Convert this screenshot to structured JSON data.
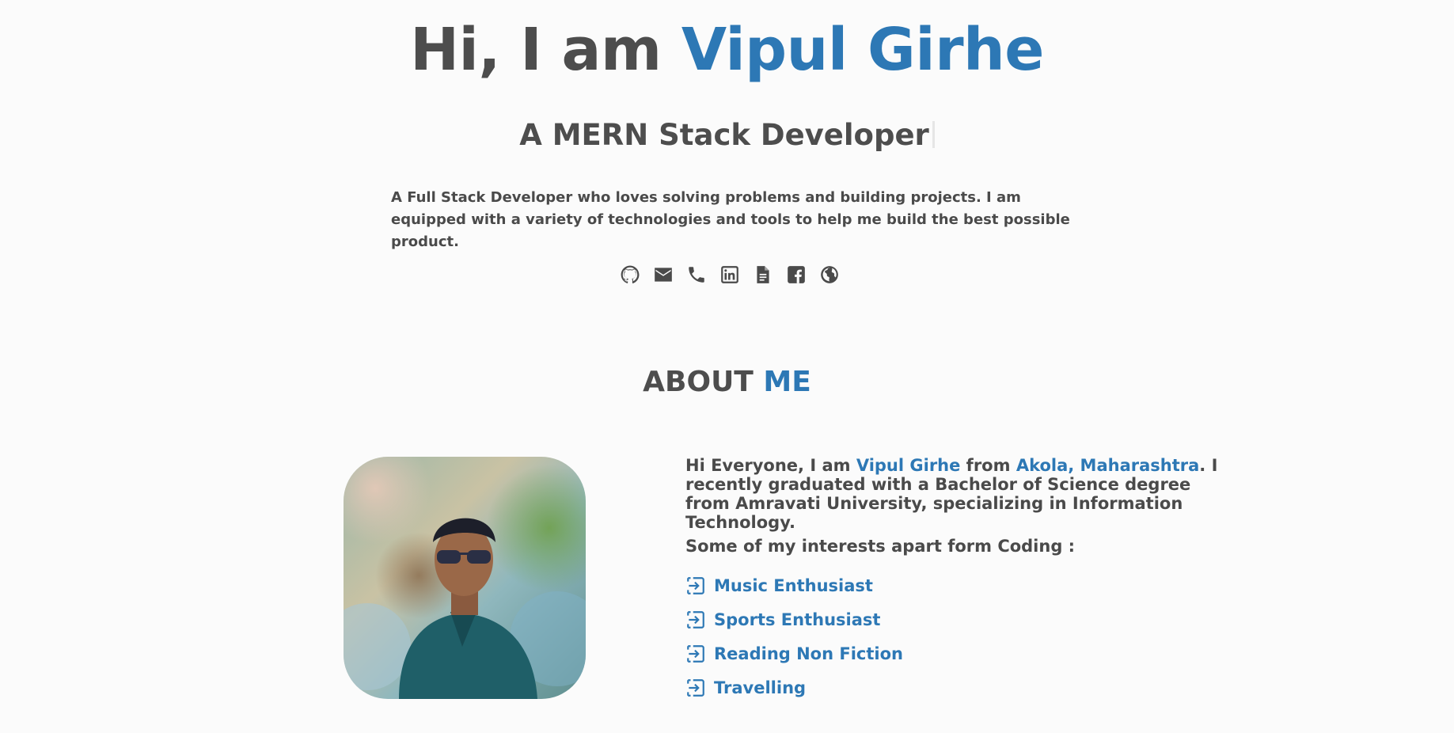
{
  "hero": {
    "greeting": "Hi, I am ",
    "name": "Vipul Girhe",
    "subtitle": "A MERN Stack Developer",
    "intro": "A Full Stack Developer who loves solving problems and building projects. I am equipped with a variety of technologies and tools to help me build the best possible product."
  },
  "socials": [
    {
      "icon": "github-icon"
    },
    {
      "icon": "email-icon"
    },
    {
      "icon": "phone-icon"
    },
    {
      "icon": "linkedin-icon"
    },
    {
      "icon": "document-icon"
    },
    {
      "icon": "facebook-icon"
    },
    {
      "icon": "globe-icon"
    }
  ],
  "about": {
    "title_part1": "ABOUT ",
    "title_part2": "ME",
    "p_start": "Hi Everyone, I am ",
    "p_name": "Vipul Girhe",
    "p_mid": " from ",
    "p_place": "Akola, Maharashtra",
    "p_end": ". I recently graduated with a Bachelor of Science degree from Amravati University, specializing in Information Technology.",
    "interests_label": "Some of my interests apart form Coding :",
    "interests": [
      "Music Enthusiast",
      "Sports Enthusiast",
      "Reading Non Fiction",
      "Travelling"
    ]
  },
  "colors": {
    "accent": "#2d78b5",
    "text": "#4d4d4d",
    "background": "#fbfbfb"
  }
}
